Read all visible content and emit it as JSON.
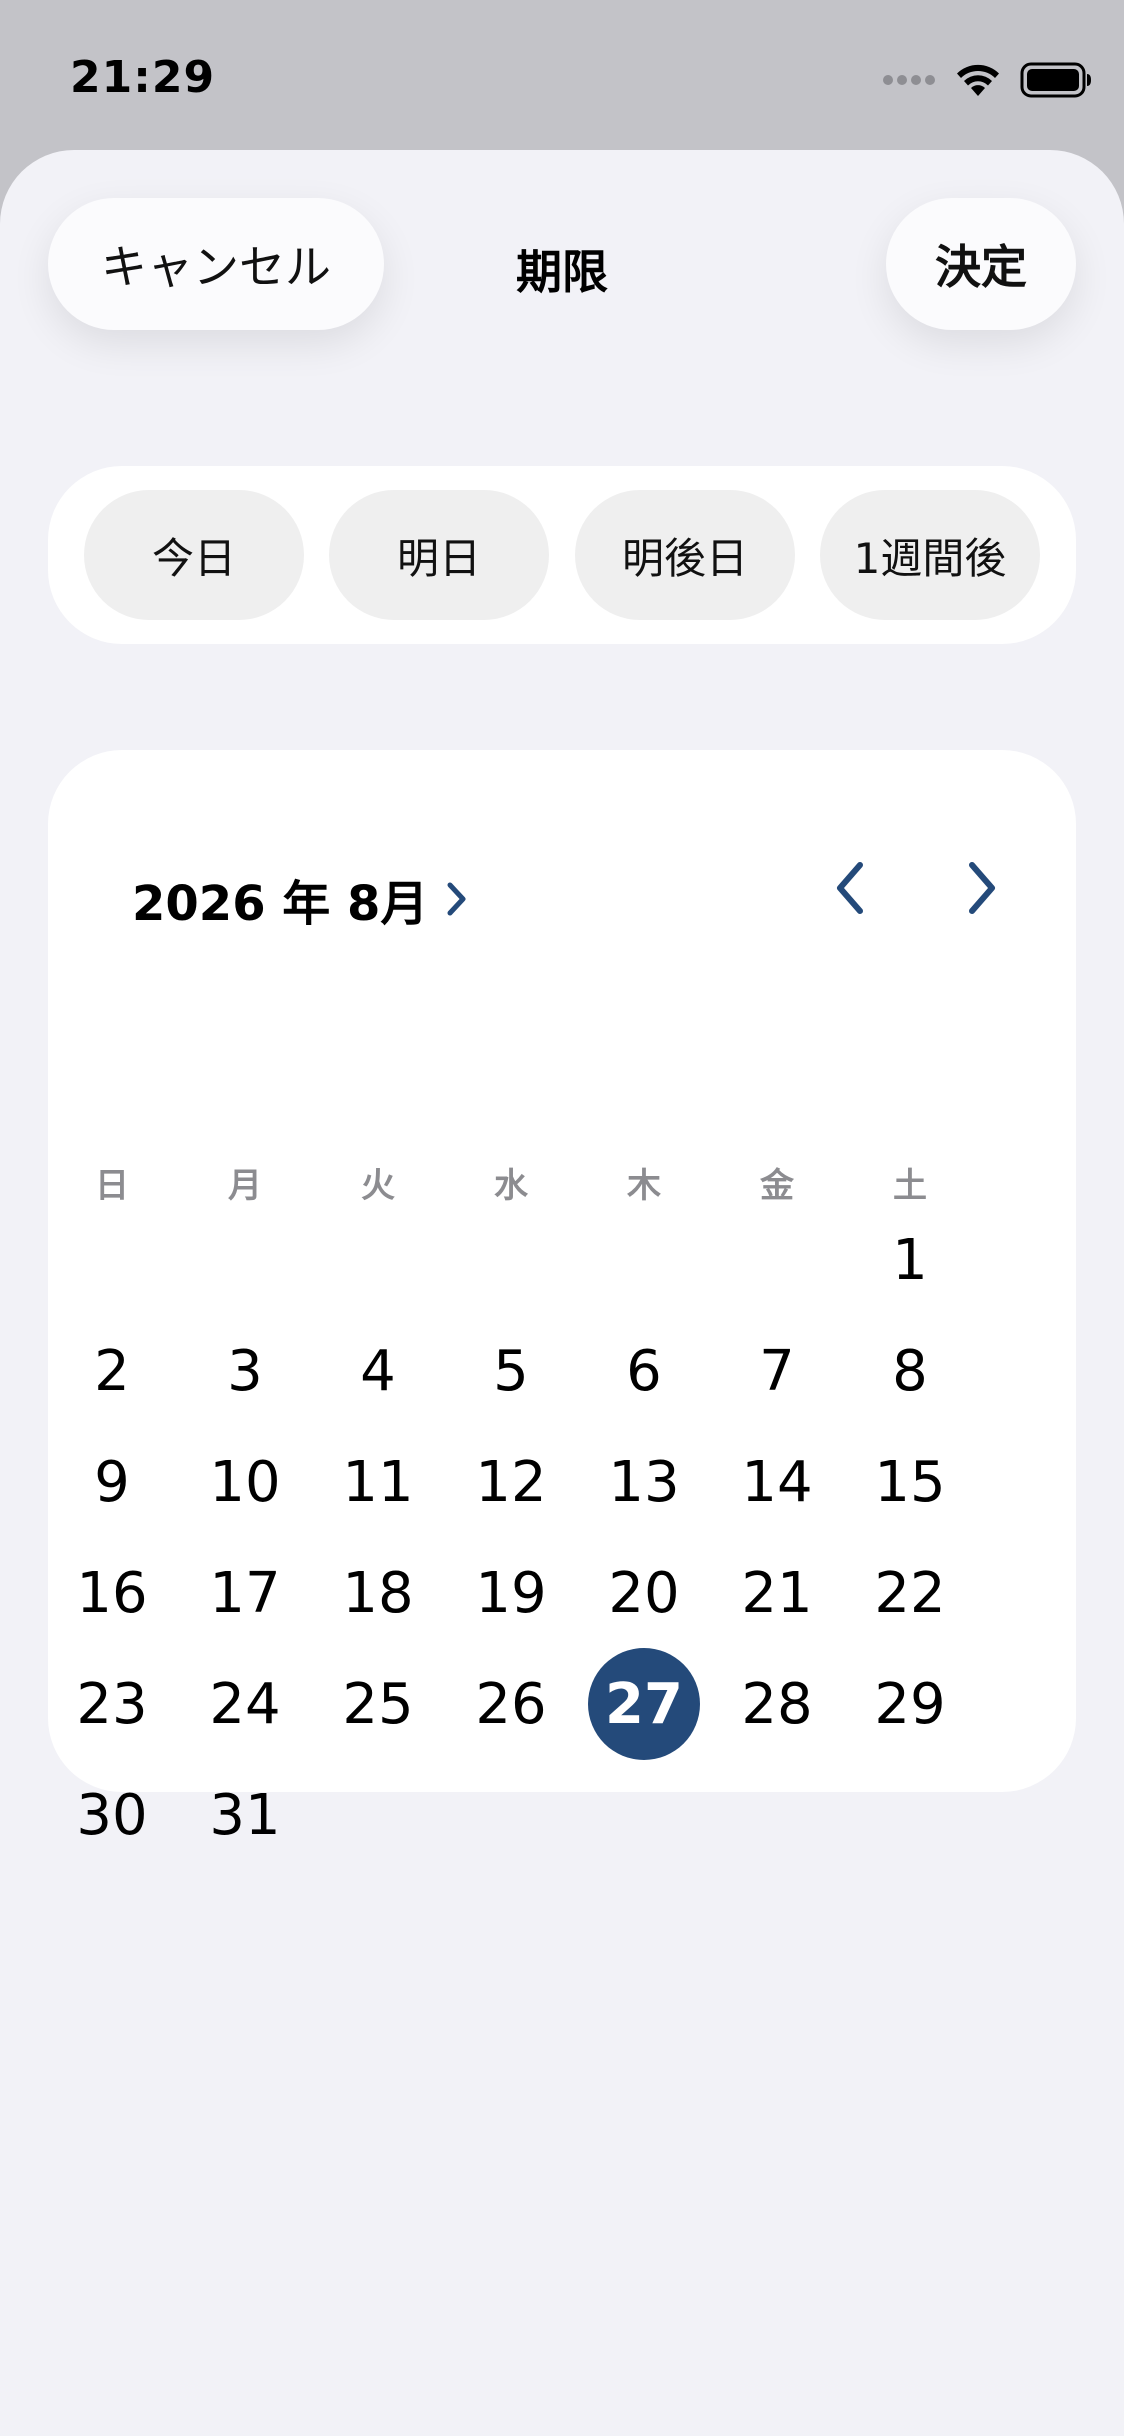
{
  "status_bar": {
    "time": "21:29"
  },
  "header": {
    "cancel_label": "キャンセル",
    "title": "期限",
    "confirm_label": "決定"
  },
  "quick_options": [
    {
      "label": "今日"
    },
    {
      "label": "明日"
    },
    {
      "label": "明後日"
    },
    {
      "label": "1週間後"
    }
  ],
  "calendar": {
    "month_label": "2026 年 8月",
    "weekdays": [
      "日",
      "月",
      "火",
      "水",
      "木",
      "金",
      "土"
    ],
    "first_weekday_index": 6,
    "days": [
      "1",
      "2",
      "3",
      "4",
      "5",
      "6",
      "7",
      "8",
      "9",
      "10",
      "11",
      "12",
      "13",
      "14",
      "15",
      "16",
      "17",
      "18",
      "19",
      "20",
      "21",
      "22",
      "23",
      "24",
      "25",
      "26",
      "27",
      "28",
      "29",
      "30",
      "31"
    ],
    "selected_day": "27"
  },
  "colors": {
    "accent": "#244a7a",
    "sheet_background": "#f2f2f7",
    "chip_background": "#efefef",
    "weekday_text": "#8c8c90"
  },
  "icons": {
    "month_disclosure": "chevron-right-icon",
    "prev": "chevron-left-icon",
    "next": "chevron-right-icon"
  }
}
